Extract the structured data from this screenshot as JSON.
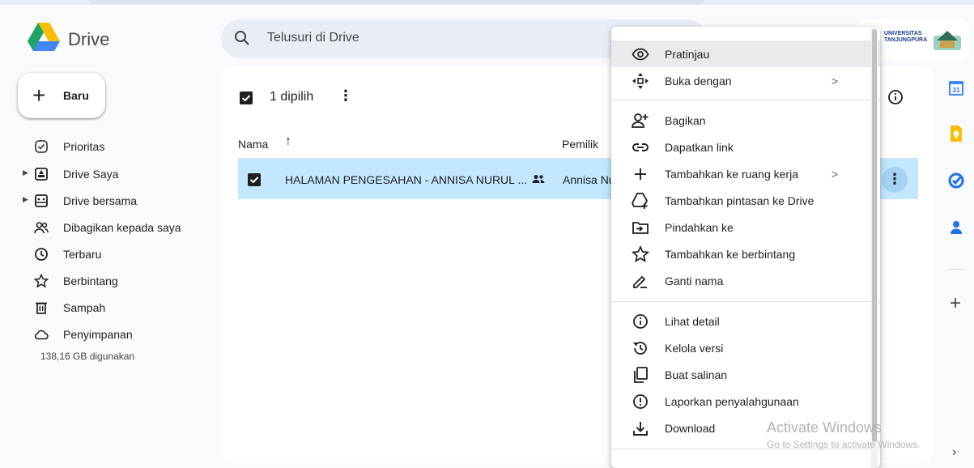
{
  "app": {
    "name": "Drive"
  },
  "search": {
    "placeholder": "Telusuri di Drive"
  },
  "new_button": {
    "label": "Baru"
  },
  "sidebar": {
    "items": [
      {
        "label": "Prioritas",
        "icon": "priority-icon"
      },
      {
        "label": "Drive Saya",
        "icon": "my-drive-icon"
      },
      {
        "label": "Drive bersama",
        "icon": "shared-drive-icon"
      },
      {
        "label": "Dibagikan kepada saya",
        "icon": "shared-with-me-icon"
      },
      {
        "label": "Terbaru",
        "icon": "clock-icon"
      },
      {
        "label": "Berbintang",
        "icon": "star-icon"
      },
      {
        "label": "Sampah",
        "icon": "trash-icon"
      },
      {
        "label": "Penyimpanan",
        "icon": "cloud-icon"
      }
    ],
    "storage_text": "138,16 GB digunakan"
  },
  "selection": {
    "text": "1 dipilih"
  },
  "table": {
    "headers": {
      "name": "Nama",
      "owner": "Pemilik"
    },
    "rows": [
      {
        "name": "HALAMAN PENGESAHAN - ANNISA NURUL ...",
        "owner": "Annisa Nurul"
      }
    ]
  },
  "account": {
    "org_line1": "UNIVERSITAS",
    "org_line2": "TANJUNGPURA"
  },
  "context_menu": {
    "items": [
      {
        "label": "Pratinjau",
        "icon": "eye-icon"
      },
      {
        "label": "Buka dengan",
        "icon": "move-arrows-icon",
        "submenu": ">"
      },
      {
        "label": "Bagikan",
        "icon": "person-add-icon"
      },
      {
        "label": "Dapatkan link",
        "icon": "link-icon"
      },
      {
        "label": "Tambahkan ke ruang kerja",
        "icon": "plus-icon",
        "submenu": ">"
      },
      {
        "label": "Tambahkan pintasan ke Drive",
        "icon": "drive-shortcut-icon"
      },
      {
        "label": "Pindahkan ke",
        "icon": "move-to-folder-icon"
      },
      {
        "label": "Tambahkan ke berbintang",
        "icon": "star-outline-icon"
      },
      {
        "label": "Ganti nama",
        "icon": "pencil-icon"
      },
      {
        "label": "Lihat detail",
        "icon": "info-icon"
      },
      {
        "label": "Kelola versi",
        "icon": "history-icon"
      },
      {
        "label": "Buat salinan",
        "icon": "copy-icon"
      },
      {
        "label": "Laporkan penyalahgunaan",
        "icon": "report-icon"
      },
      {
        "label": "Download",
        "icon": "download-icon"
      }
    ]
  },
  "watermark": {
    "line1": "Activate Windows",
    "line2": "Go to Settings to activate Windows."
  },
  "colors": {
    "selected_row": "#c2e7ff",
    "menu_highlight": "#e8eaed",
    "accent_blue": "#0b57d0"
  }
}
